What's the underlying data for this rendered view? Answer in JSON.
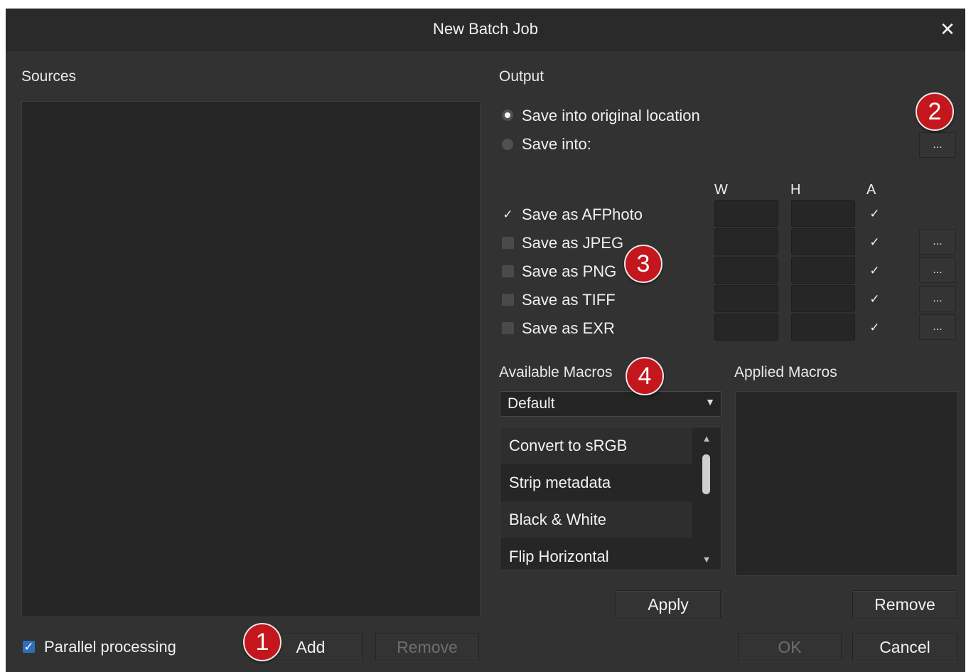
{
  "window": {
    "title": "New Batch Job",
    "close_glyph": "✕"
  },
  "sources": {
    "label": "Sources"
  },
  "output": {
    "label": "Output",
    "radio_original": "Save into original location",
    "radio_into": "Save into:",
    "browse_label": "...",
    "columns": {
      "w": "W",
      "h": "H",
      "a": "A"
    },
    "formats": [
      {
        "label": "Save as AFPhoto",
        "checked": true,
        "a_checked": true,
        "has_options": false
      },
      {
        "label": "Save as JPEG",
        "checked": false,
        "a_checked": true,
        "has_options": true
      },
      {
        "label": "Save as PNG",
        "checked": false,
        "a_checked": true,
        "has_options": true
      },
      {
        "label": "Save as TIFF",
        "checked": false,
        "a_checked": true,
        "has_options": true
      },
      {
        "label": "Save as EXR",
        "checked": false,
        "a_checked": true,
        "has_options": true
      }
    ],
    "options_label": "..."
  },
  "macros": {
    "available_label": "Available Macros",
    "applied_label": "Applied Macros",
    "category": "Default",
    "items": [
      "Convert to sRGB",
      "Strip metadata",
      "Black & White",
      "Flip Horizontal"
    ],
    "apply_label": "Apply",
    "remove_label": "Remove"
  },
  "footer": {
    "parallel_label": "Parallel processing",
    "parallel_checked": true,
    "add_label": "Add",
    "remove_label": "Remove",
    "ok_label": "OK",
    "cancel_label": "Cancel"
  },
  "badges": [
    "1",
    "2",
    "3",
    "4"
  ],
  "colors": {
    "accent_badge": "#c4171d",
    "checkbox_blue": "#2d6fbd",
    "dialog_bg": "#323232"
  }
}
